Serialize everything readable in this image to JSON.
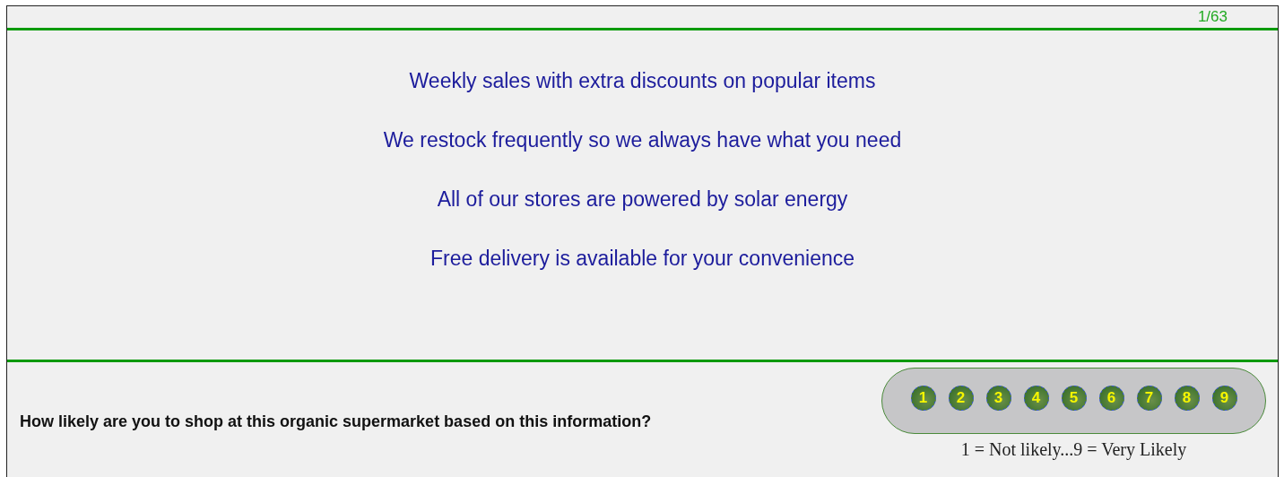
{
  "counter": "1/63",
  "statements": [
    "Weekly sales with extra discounts on popular items",
    "We restock frequently so we always have what you need",
    "All of our stores are powered by solar energy",
    "Free delivery is available for your convenience"
  ],
  "question": "How likely are you to shop at this organic supermarket based on this information?",
  "scale": {
    "options": [
      "1",
      "2",
      "3",
      "4",
      "5",
      "6",
      "7",
      "8",
      "9"
    ],
    "caption": "1 = Not likely...9 = Very Likely"
  }
}
